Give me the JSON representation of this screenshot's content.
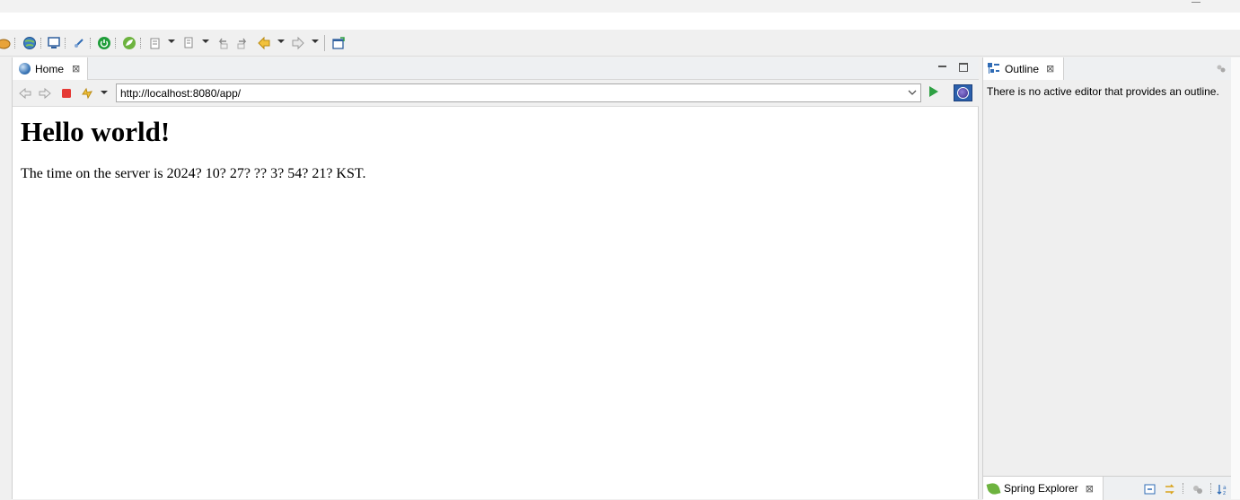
{
  "toolbar": {
    "icons": [
      "open-task-icon",
      "web-browser-icon",
      "console-icon",
      "debug-icon",
      "server-start-icon",
      "spring-icon",
      "ant-build-icon",
      "build-icon",
      "back-edit-icon",
      "forward-edit-icon",
      "back-icon",
      "forward-icon",
      "new-window-icon",
      "search-icon"
    ]
  },
  "editor": {
    "tab_label": "Home",
    "tab_close": "⊠",
    "url": "http://localhost:8080/app/"
  },
  "page": {
    "heading": "Hello world!",
    "body": "The time on the server is 2024? 10? 27? ?? 3? 54? 21? KST."
  },
  "outline": {
    "tab_label": "Outline",
    "tab_close": "⊠",
    "message": "There is no active editor that provides an outline."
  },
  "spring_explorer": {
    "tab_label": "Spring Explorer",
    "tab_close": "⊠"
  },
  "colors": {
    "highlight_circle": "#e0141e",
    "go_button": "#2ea043",
    "stop_button": "#e53935",
    "spring_green": "#6db33f"
  }
}
